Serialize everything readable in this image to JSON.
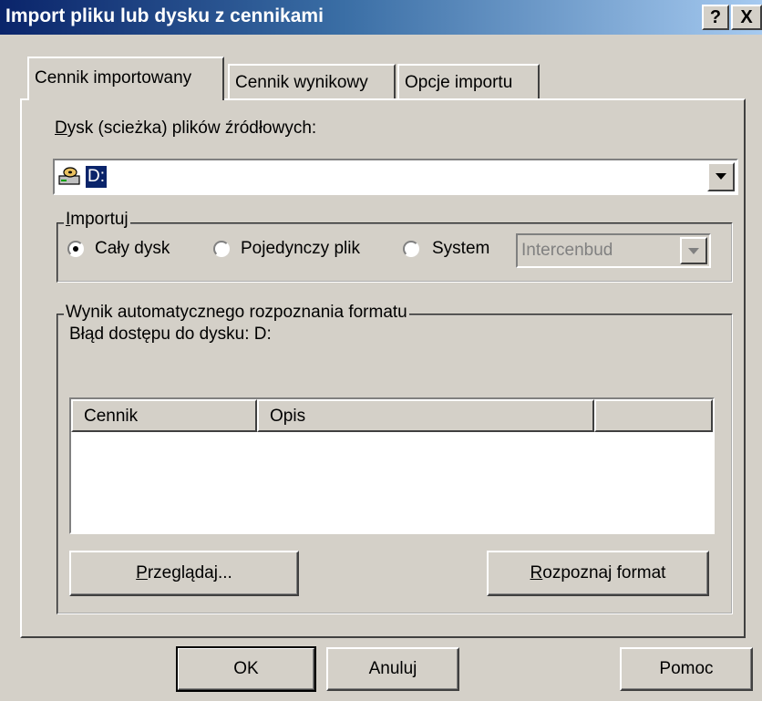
{
  "window": {
    "title": "Import pliku lub dysku z cennikami",
    "help_glyph": "?",
    "close_glyph": "X"
  },
  "tabs": [
    {
      "label": "Cennik importowany",
      "active": true
    },
    {
      "label": "Cennik wynikowy",
      "active": false
    },
    {
      "label": "Opcje importu",
      "active": false
    }
  ],
  "source": {
    "label_mnemonic": "D",
    "label_rest": "ysk (scieżka) plików źródłowych:",
    "icon": "drive-icon",
    "value": "D:"
  },
  "import_group": {
    "label_mnemonic": "I",
    "label_rest": "mportuj",
    "options": [
      {
        "label": "Cały dysk",
        "selected": true
      },
      {
        "label": "Pojedynczy plik",
        "selected": false
      },
      {
        "label": "System",
        "selected": false
      }
    ],
    "system_select_value": "Intercenbud"
  },
  "detect_group": {
    "label": "Wynik automatycznego rozpoznania formatu",
    "message": "Błąd dostępu do dysku: D:",
    "columns": [
      "Cennik",
      "Opis",
      ""
    ],
    "rows": []
  },
  "buttons": {
    "browse_mnemonic": "P",
    "browse_rest": "rzeglądaj...",
    "detect_mnemonic": "R",
    "detect_rest": "ozpoznaj format",
    "ok": "OK",
    "cancel": "Anuluj",
    "help": "Pomoc"
  },
  "colors": {
    "title_start": "#0a246a",
    "title_end": "#a6caf0",
    "face": "#d4d0c8",
    "selection": "#0a246a"
  }
}
